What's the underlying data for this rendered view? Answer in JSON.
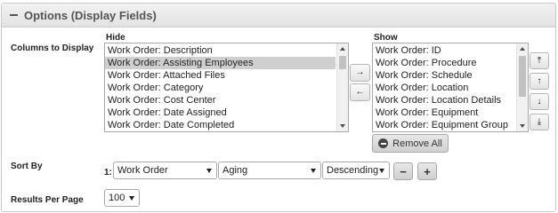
{
  "panel": {
    "title": "Options (Display Fields)"
  },
  "columns": {
    "label": "Columns to Display",
    "hide_label": "Hide",
    "show_label": "Show",
    "hide_items": [
      {
        "label": "Work Order: Description",
        "selected": false
      },
      {
        "label": "Work Order: Assisting Employees",
        "selected": true
      },
      {
        "label": "Work Order: Attached Files",
        "selected": false
      },
      {
        "label": "Work Order: Category",
        "selected": false
      },
      {
        "label": "Work Order: Cost Center",
        "selected": false
      },
      {
        "label": "Work Order: Date Assigned",
        "selected": false
      },
      {
        "label": "Work Order: Date Completed",
        "selected": false
      }
    ],
    "show_items": [
      {
        "label": "Work Order: ID",
        "selected": false
      },
      {
        "label": "Work Order: Procedure",
        "selected": false
      },
      {
        "label": "Work Order: Schedule",
        "selected": false
      },
      {
        "label": "Work Order: Location",
        "selected": false
      },
      {
        "label": "Work Order: Location Details",
        "selected": false
      },
      {
        "label": "Work Order: Equipment",
        "selected": false
      },
      {
        "label": "Work Order: Equipment Group",
        "selected": false
      }
    ],
    "move_right_icon": "→",
    "move_left_icon": "←",
    "move_top_icon": "⤒",
    "move_up_icon": "↑",
    "move_down_icon": "↓",
    "move_bottom_icon": "⤓",
    "remove_all_label": "Remove All"
  },
  "sort": {
    "label": "Sort By",
    "rank": "1:",
    "field": "Work Order",
    "subfield": "Aging",
    "direction": "Descending",
    "remove_label": "−",
    "add_label": "+"
  },
  "results": {
    "label": "Results Per Page",
    "value": "100"
  }
}
